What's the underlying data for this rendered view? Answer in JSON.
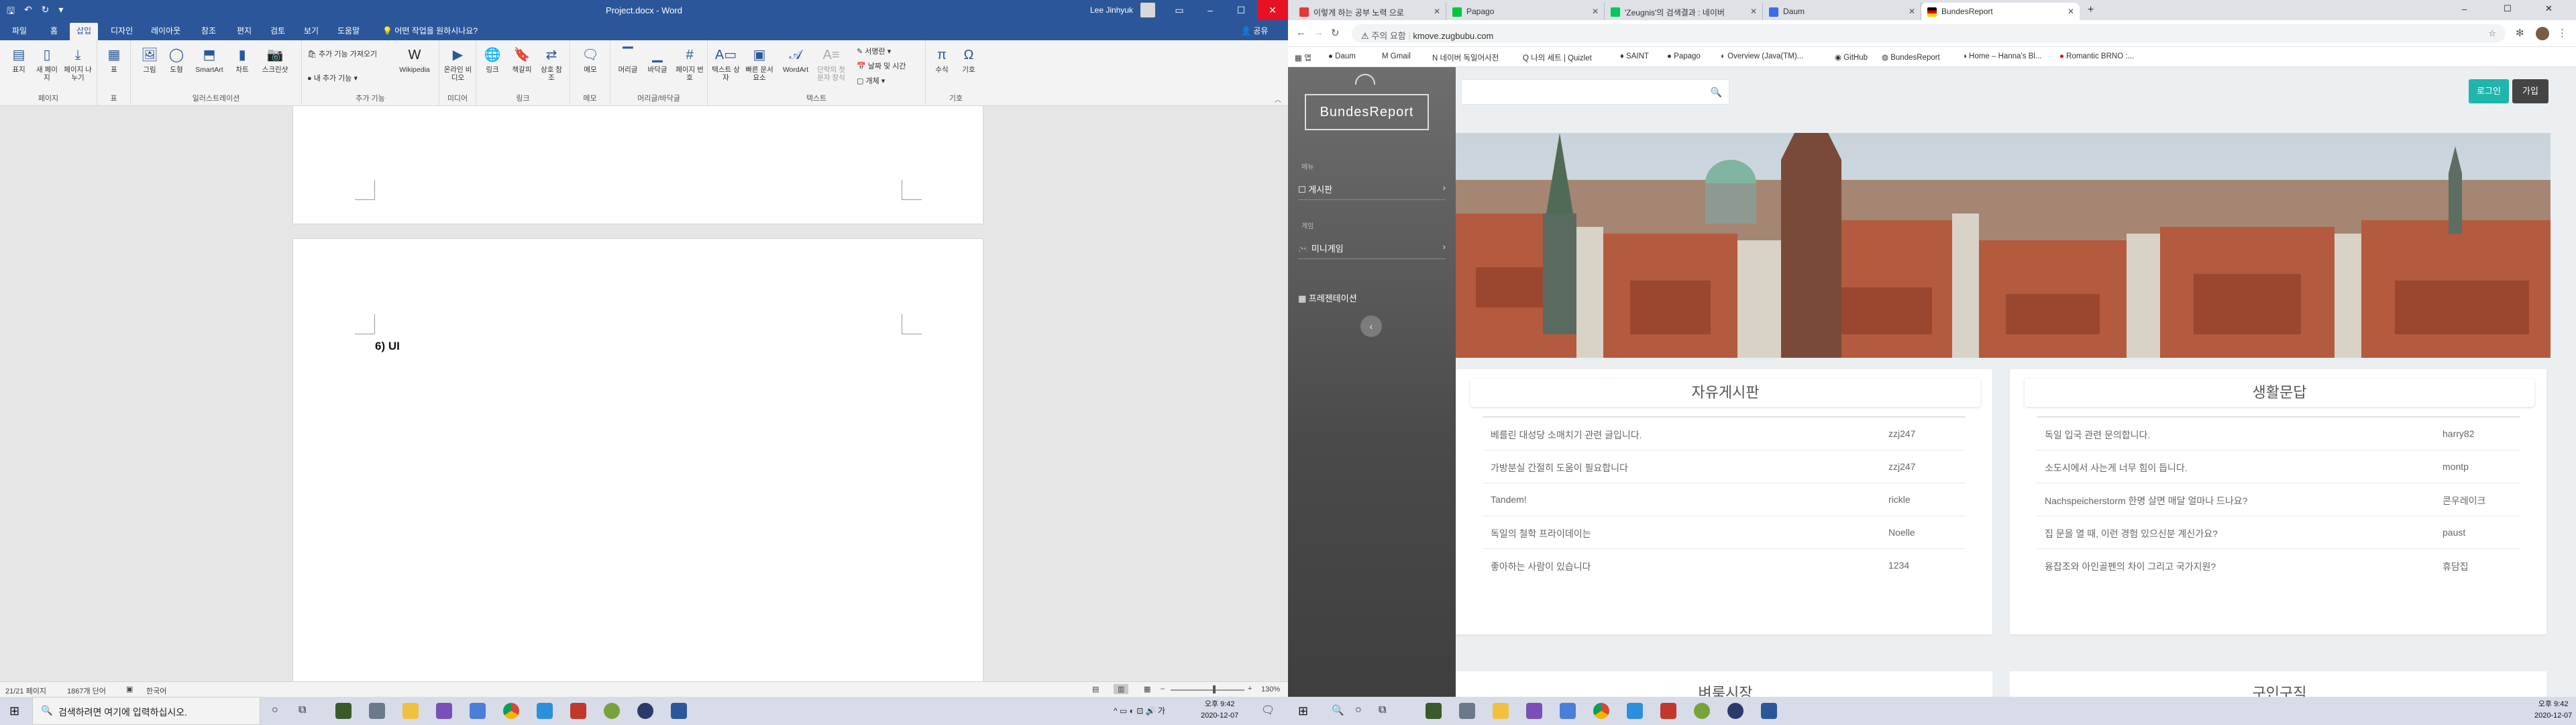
{
  "word": {
    "window_title": "Project.docx - Word",
    "user": "Lee Jinhyuk",
    "qat_icons": [
      "save-icon",
      "undo-icon",
      "redo-icon",
      "customize-icon"
    ],
    "tabs": [
      "파일",
      "홈",
      "삽입",
      "디자인",
      "레이아웃",
      "참조",
      "편지",
      "검토",
      "보기",
      "도움말"
    ],
    "active_tab": "삽입",
    "tell_me": "어떤 작업을 원하시나요?",
    "share": "공유",
    "ribbon": {
      "groups": [
        {
          "label": "페이지",
          "buttons": [
            "표지",
            "새 페이지",
            "페이지 나누기"
          ]
        },
        {
          "label": "표",
          "buttons": [
            "표"
          ]
        },
        {
          "label": "일러스트레이션",
          "buttons": [
            "그림",
            "도형",
            "SmartArt",
            "차트",
            "스크린샷"
          ]
        },
        {
          "label": "추가 기능",
          "buttons": [
            "추가 기능 가져오기",
            "내 추가 기능",
            "Wikipedia"
          ]
        },
        {
          "label": "미디어",
          "buttons": [
            "온라인 비디오"
          ]
        },
        {
          "label": "링크",
          "buttons": [
            "링크",
            "책갈피",
            "상호 참조"
          ]
        },
        {
          "label": "메모",
          "buttons": [
            "메모"
          ]
        },
        {
          "label": "머리글/바닥글",
          "buttons": [
            "머리글",
            "바닥글",
            "페이지 번호"
          ]
        },
        {
          "label": "텍스트",
          "buttons": [
            "텍스트 상자",
            "빠른 문서 요소",
            "WordArt",
            "단락의 첫 문자 장식",
            "서명란",
            "날짜 및 시간",
            "개체"
          ]
        },
        {
          "label": "기호",
          "buttons": [
            "수식",
            "기호"
          ]
        }
      ]
    },
    "page_heading": "6) UI",
    "status": {
      "page": "21/21 페이지",
      "words": "1867개 단어",
      "lang": "한국어",
      "zoom": "130%"
    }
  },
  "chrome": {
    "tabs": [
      {
        "label": "이렇게 하는 공부 노력 으로",
        "color": "#e53935"
      },
      {
        "label": "Papago",
        "color": "#00c73c"
      },
      {
        "label": "'Zeugnis'의 검색결과 : 네이버",
        "color": "#03c75a"
      },
      {
        "label": "Daum",
        "color": "#3a6ee8"
      },
      {
        "label": "BundesReport",
        "color": "#dd0000",
        "active": true
      }
    ],
    "security": "주의 요함",
    "url": "kmove.zugbubu.com",
    "bookmarks": [
      "앱",
      "Daum",
      "Gmail",
      "네이버 독일어사전",
      "나의 세트 | Quizlet",
      "SAINT",
      "Papago",
      "Overview (Java(TM)...",
      "GitHub",
      "BundesReport",
      "Home – Hanna's Bl...",
      "Romantic BRNO :..."
    ]
  },
  "site": {
    "logo": "BundesReport",
    "sidebar": [
      {
        "header": "메뉴",
        "item": "게시판"
      },
      {
        "header": "게임",
        "item": "미니게임"
      },
      {
        "header": "",
        "item": "프레젠테이션"
      }
    ],
    "login": "로그인",
    "join": "가입",
    "boards": [
      {
        "title": "자유게시판",
        "posts": [
          {
            "title": "베를린 대성당 소매치기 관련 글입니다.",
            "author": "zzj247"
          },
          {
            "title": "가방분실 간절히 도움이 필요합니다",
            "author": "zzj247"
          },
          {
            "title": "Tandem!",
            "author": "rickle"
          },
          {
            "title": "독일의 철학 프라이데이는",
            "author": "Noelle"
          },
          {
            "title": "좋아하는 사람이 있습니다",
            "author": "1234"
          }
        ]
      },
      {
        "title": "생활문답",
        "posts": [
          {
            "title": "독일 입국 관련 문의합니다.",
            "author": "harry82"
          },
          {
            "title": "소도시에서 사는게 너무 힘이 듭니다.",
            "author": "montp"
          },
          {
            "title": "Nachspeicherstorm 한명 살면 매달 얼마나 드나요?",
            "author": "콘우레이크"
          },
          {
            "title": "집 문을 열 때, 이런 경험 있으신분 계신가요?",
            "author": "paust"
          },
          {
            "title": "융잡조와 아인골펜의 차이 그리고 국가지원?",
            "author": "휴담집"
          }
        ]
      }
    ],
    "lower_boards": [
      "벼룩시장",
      "구인구직"
    ]
  },
  "taskbar": {
    "search_placeholder": "검색하려면 여기에 입력하십시오.",
    "time": "오후 9:42",
    "date": "2020-12-07",
    "time2": "오후 9:42",
    "date2": "2020-12-07"
  }
}
